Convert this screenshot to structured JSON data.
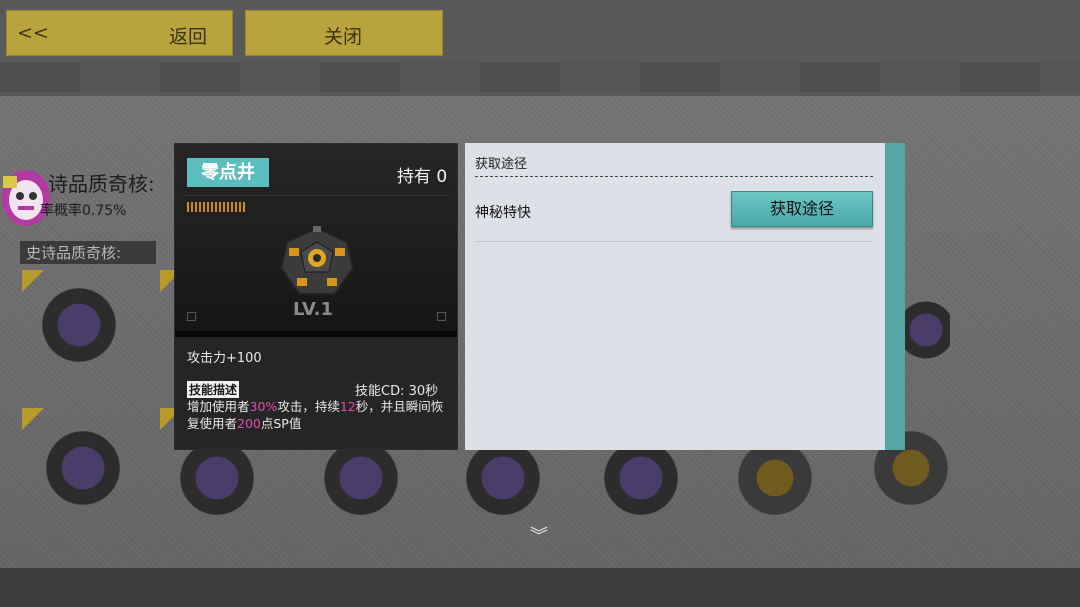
{
  "nav": {
    "back_arrow": "<<",
    "back_label": "返回",
    "close_label": "关闭"
  },
  "background": {
    "rarity_title": "诗品质奇核:",
    "probability": "率概率0.75%",
    "section_label": "史诗品质奇核:",
    "more_icon": "chevron-double-down-icon"
  },
  "card": {
    "name": "零点井",
    "own_label": "持有 0",
    "level": "LV.1",
    "attack": "攻击力+100",
    "skill_tag": "技能描述",
    "cooldown": "技能CD: 30秒",
    "desc": {
      "p1": "增加使用者",
      "v1": "30%",
      "p2": "攻击，持续",
      "v2": "12",
      "p3": "秒，并且瞬间恢复使用者",
      "v3": "200",
      "p4": "点SP值"
    },
    "accent_color": "#5bbdbd",
    "highlight_color": "#e24bb8"
  },
  "panel": {
    "title": "获取途径",
    "source_label": "神秘特快",
    "source_button": "获取途径"
  }
}
